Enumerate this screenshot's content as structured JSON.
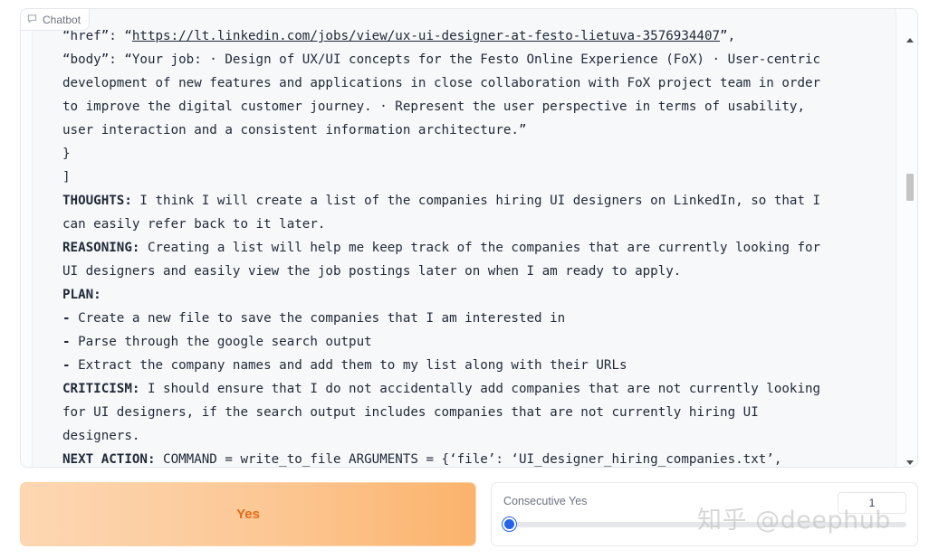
{
  "chatbot": {
    "label": "Chatbot",
    "lines": [
      {
        "prefix": "",
        "text": "“href”: “https://lt.linkedin.com/jobs/view/ux-ui-designer-at-festo-lietuva-3576934407”,"
      },
      {
        "prefix": "",
        "text": "“body”: “Your job: · Design of UX/UI concepts for the Festo Online Experience (FoX) · User-centric"
      },
      {
        "prefix": "",
        "text": "development of new features and applications in close collaboration with FoX project team in order"
      },
      {
        "prefix": "",
        "text": "to improve the digital customer journey. · Represent the user perspective in terms of usability,"
      },
      {
        "prefix": "",
        "text": "user interaction and a consistent information architecture.”"
      },
      {
        "prefix": "",
        "text": "}"
      },
      {
        "prefix": "",
        "text": "]"
      },
      {
        "prefix": "THOUGHTS:",
        "text": " I think I will create a list of the companies hiring UI designers on LinkedIn, so that I"
      },
      {
        "prefix": "",
        "text": "can easily refer back to it later."
      },
      {
        "prefix": "REASONING:",
        "text": " Creating a list will help me keep track of the companies that are currently looking for"
      },
      {
        "prefix": "",
        "text": "UI designers and easily view the job postings later on when I am ready to apply."
      },
      {
        "prefix": "PLAN:",
        "text": ""
      },
      {
        "prefix": "-",
        "text": " Create a new file to save the companies that I am interested in"
      },
      {
        "prefix": "-",
        "text": " Parse through the google search output"
      },
      {
        "prefix": "-",
        "text": " Extract the company names and add them to my list along with their URLs"
      },
      {
        "prefix": "CRITICISM:",
        "text": " I should ensure that I do not accidentally add companies that are not currently looking"
      },
      {
        "prefix": "",
        "text": "for UI designers, if the search output includes companies that are not currently hiring UI"
      },
      {
        "prefix": "",
        "text": "designers."
      },
      {
        "prefix": "NEXT ACTION:",
        "text": " COMMAND = write_to_file ARGUMENTS = {‘file’: ‘UI_designer_hiring_companies.txt’,"
      }
    ]
  },
  "yes_button": {
    "label": "Yes"
  },
  "consecutive": {
    "label": "Consecutive Yes",
    "value": "1",
    "slider_fraction": 0.0
  },
  "watermark": {
    "text": "知乎 @deephub"
  }
}
